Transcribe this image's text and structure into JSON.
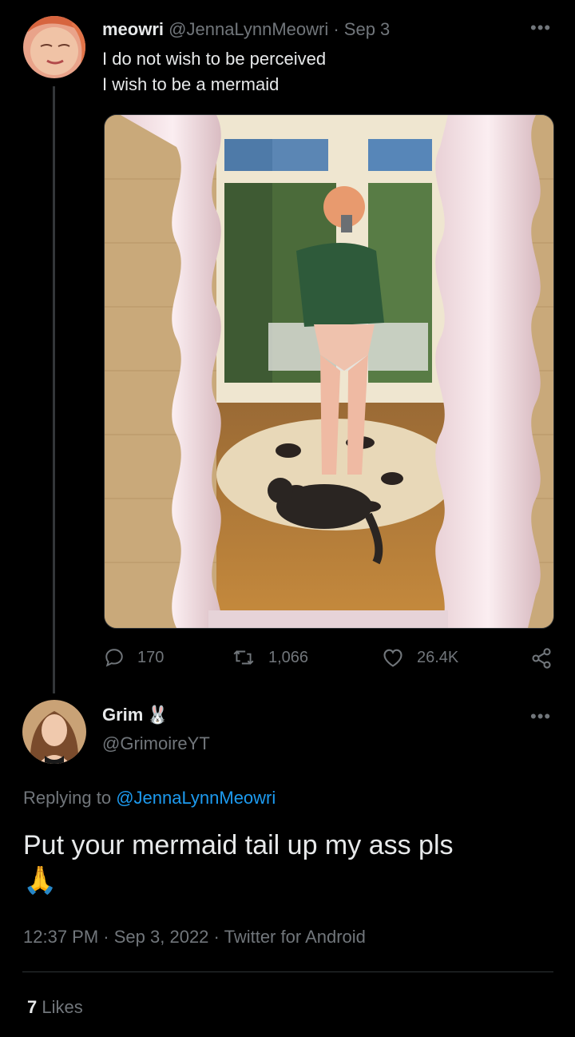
{
  "tweet": {
    "author_name": "meowri",
    "author_handle": "@JennaLynnMeowri",
    "separator": "·",
    "date": "Sep 3",
    "line1": "I do not wish to be perceived",
    "line2": "I wish to be a mermaid",
    "replies": "170",
    "retweets": "1,066",
    "likes": "26.4K"
  },
  "reply": {
    "author_name": "Grim",
    "author_emoji": "🐰",
    "author_handle": "@GrimoireYT",
    "replying_prefix": "Replying to",
    "replying_handle": "@JennaLynnMeowri",
    "text": "Put your mermaid tail up my ass pls",
    "emoji": "🙏",
    "time": "12:37 PM",
    "date": "Sep 3, 2022",
    "source": "Twitter for Android",
    "likes_count": "7",
    "likes_label": "Likes"
  },
  "icons": {
    "reply": "speech-bubble-icon",
    "retweet": "retweet-icon",
    "like": "heart-icon",
    "share": "share-icon",
    "more": "more-dots-icon"
  },
  "colors": {
    "background": "#000000",
    "text": "#e7e9ea",
    "muted": "#71767b",
    "link": "#1d9bf0"
  }
}
